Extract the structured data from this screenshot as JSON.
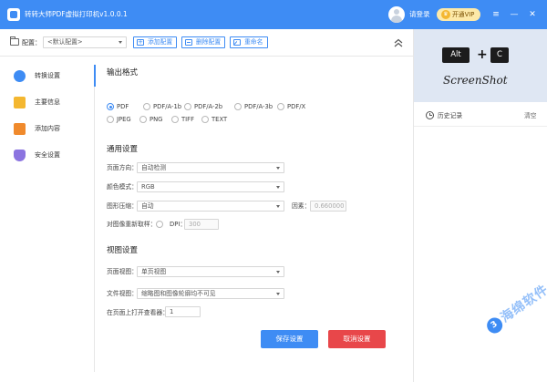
{
  "titlebar": {
    "title": "转转大师PDF虚拟打印机v1.0.0.1",
    "login_label": "请登录",
    "vip_label": "开通VIP",
    "vip_icon_glyph": "♛"
  },
  "toolbar": {
    "preset_label": "配置：",
    "preset_value": "<默认配置>",
    "add_label": "添加配置",
    "delete_label": "删除配置",
    "rename_label": "重命名"
  },
  "nav": {
    "items": [
      {
        "label": "转换设置",
        "color": "#3e8cf4"
      },
      {
        "label": "主要信息",
        "color": "#f4b730"
      },
      {
        "label": "添加内容",
        "color": "#f08a2c"
      },
      {
        "label": "安全设置",
        "color": "#8b74e0"
      }
    ]
  },
  "output": {
    "title": "输出格式",
    "formats": [
      "PDF",
      "PDF/A-1b",
      "PDF/A-2b",
      "PDF/A-3b",
      "PDF/X",
      "JPEG",
      "PNG",
      "TIFF",
      "TEXT"
    ],
    "selected": "PDF"
  },
  "general": {
    "title": "通用设置",
    "orientation_label": "页面方向：",
    "orientation_value": "自动检测",
    "color_label": "颜色模式：",
    "color_value": "RGB",
    "compress_label": "图形压缩：",
    "compress_value": "自动",
    "factor_label": "因素：",
    "factor_value": "0.660000",
    "resample_label": "对图像重新取样：",
    "dpi_label": "DPI：",
    "dpi_value": "300"
  },
  "view": {
    "title": "视图设置",
    "page_view_label": "页面视图：",
    "page_view_value": "单页视图",
    "file_view_label": "文件视图：",
    "file_view_value": "缩略图和图像轮廓均不可见",
    "open_page_label": "在页面上打开查看器：",
    "open_page_value": "1"
  },
  "actions": {
    "save_label": "保存设置",
    "cancel_label": "取消设置"
  },
  "preview": {
    "key_alt": "Alt",
    "key_plus": "+",
    "key_c": "C",
    "caption": "ScreenShot"
  },
  "history": {
    "label": "历史记录",
    "clear_label": "清空"
  },
  "watermark": {
    "badge": "3",
    "text": "海绵软件"
  },
  "colors": {
    "accent": "#3e8cf4",
    "cancel": "#e8474a",
    "vip_bg": "#fde9a8"
  }
}
